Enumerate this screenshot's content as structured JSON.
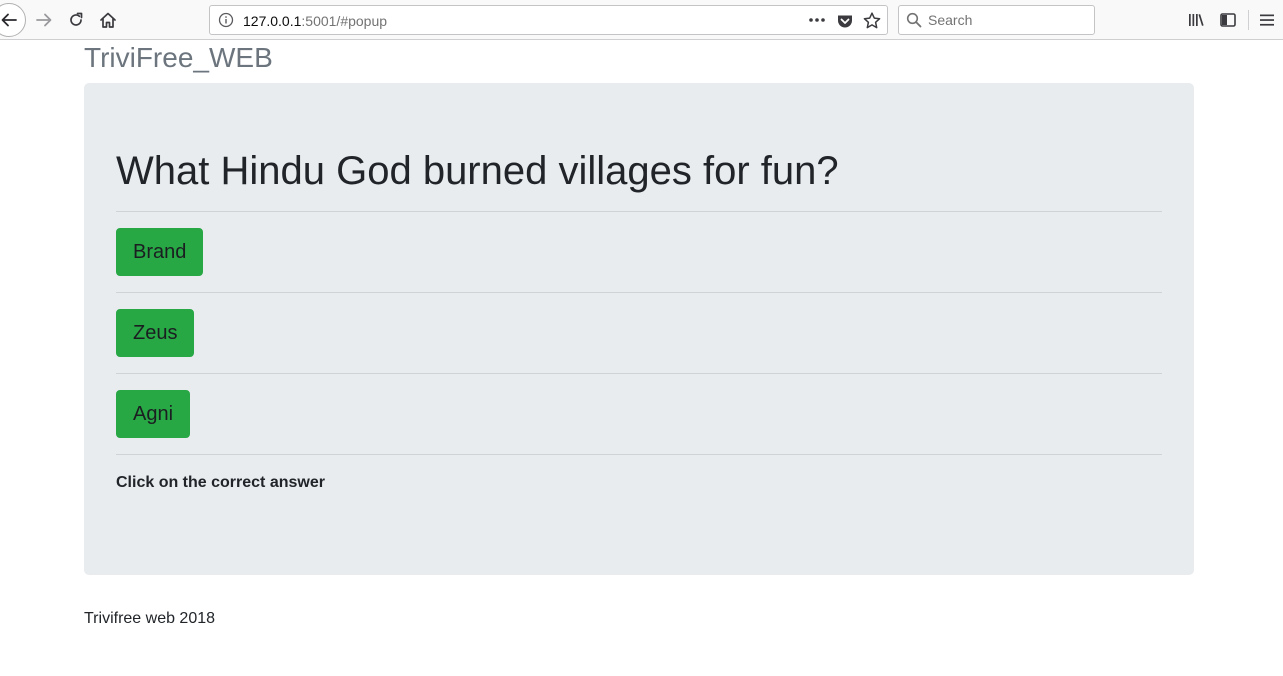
{
  "browser": {
    "url_host": "127.0.0.1",
    "url_rest": ":5001/#popup",
    "search_placeholder": "Search",
    "icons": {
      "back": "arrow-left-icon",
      "forward": "arrow-right-icon",
      "reload": "reload-icon",
      "home": "home-icon",
      "info": "info-icon",
      "page_actions": "ellipsis-icon",
      "pocket": "pocket-icon",
      "bookmark": "star-icon",
      "search": "search-icon",
      "library": "library-icon",
      "sidebar": "sidebar-icon",
      "menu": "hamburger-menu-icon"
    }
  },
  "page": {
    "brand": "TriviFree_WEB",
    "question": "What Hindu God burned villages for fun?",
    "answers": [
      {
        "label": "Brand"
      },
      {
        "label": "Zeus"
      },
      {
        "label": "Agni"
      }
    ],
    "instruction": "Click on the correct answer",
    "footer": "Trivifree web 2018"
  },
  "colors": {
    "answer_button": "#28a745",
    "jumbotron": "#e9ecef",
    "brand_text": "#6c757d"
  }
}
